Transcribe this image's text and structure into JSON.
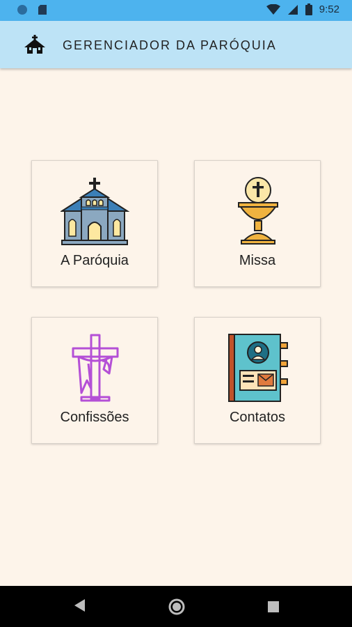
{
  "status_bar": {
    "time": "9:52"
  },
  "app_bar": {
    "title": "GERENCIADOR DA PARÓQUIA",
    "icon": "church-home-icon"
  },
  "menu": [
    {
      "label": "A Paróquia",
      "icon": "church-icon"
    },
    {
      "label": "Missa",
      "icon": "chalice-icon"
    },
    {
      "label": "Confissões",
      "icon": "cross-icon"
    },
    {
      "label": "Contatos",
      "icon": "contact-book-icon"
    }
  ],
  "nav_bar": {
    "back": "back-icon",
    "home": "home-circle-icon",
    "recents": "recents-icon"
  }
}
